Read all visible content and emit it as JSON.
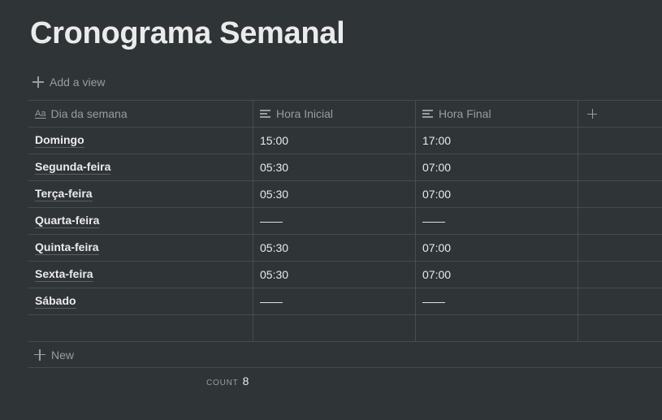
{
  "page": {
    "title": "Cronograma Semanal",
    "add_view_label": "Add a view"
  },
  "table": {
    "columns": [
      {
        "label": "Dia da semana",
        "icon": "title-property-icon"
      },
      {
        "label": "Hora Inicial",
        "icon": "text-property-icon"
      },
      {
        "label": "Hora Final",
        "icon": "text-property-icon"
      }
    ],
    "title_icon_glyph": "Aa",
    "rows": [
      {
        "day": "Domingo",
        "start": "15:00",
        "end": "17:00"
      },
      {
        "day": "Segunda-feira",
        "start": "05:30",
        "end": "07:00"
      },
      {
        "day": "Terça-feira",
        "start": "05:30",
        "end": "07:00"
      },
      {
        "day": "Quarta-feira",
        "start": "——",
        "end": "——"
      },
      {
        "day": "Quinta-feira",
        "start": "05:30",
        "end": "07:00"
      },
      {
        "day": "Sexta-feira",
        "start": "05:30",
        "end": "07:00"
      },
      {
        "day": "Sábado",
        "start": "——",
        "end": "——"
      },
      {
        "day": "",
        "start": "",
        "end": ""
      }
    ],
    "new_label": "New"
  },
  "footer": {
    "count_label": "COUNT",
    "count_value": "8"
  },
  "colors": {
    "background": "#2f3437",
    "text": "#ebebeb",
    "muted": "#9b9c9e",
    "border": "#474c50"
  }
}
